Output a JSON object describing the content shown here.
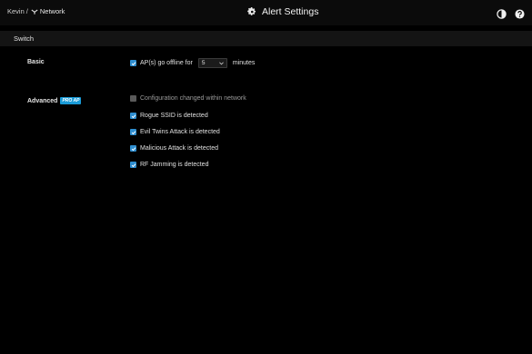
{
  "header": {
    "breadcrumb_user": "Kevin",
    "breadcrumb_sep": "/",
    "breadcrumb_network": "Network",
    "title": "Alert Settings",
    "icons": [
      "theme-toggle-icon",
      "help-icon"
    ]
  },
  "section": {
    "title": "Switch"
  },
  "basic": {
    "label": "Basic",
    "offline_prefix": "AP(s) go offline for",
    "offline_value": "5",
    "offline_suffix": "minutes",
    "checked": true
  },
  "advanced": {
    "label": "Advanced",
    "badge": "PRO AP",
    "options": [
      {
        "label": "Configuration changed within network",
        "checked": false
      },
      {
        "label": "Rogue SSID is detected",
        "checked": true
      },
      {
        "label": "Evil Twins Attack is detected",
        "checked": true
      },
      {
        "label": "Malicious Attack is detected",
        "checked": true
      },
      {
        "label": "RF Jamming is detected",
        "checked": true
      }
    ]
  },
  "colors": {
    "accent": "#2f8fd1",
    "badge": "#1a9bd7",
    "background": "#000000"
  }
}
